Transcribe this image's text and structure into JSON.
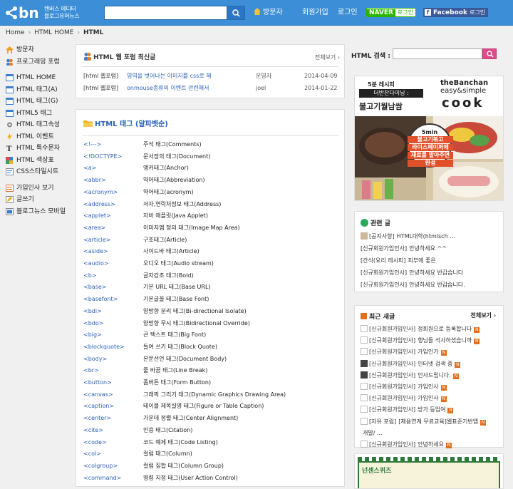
{
  "header": {
    "logo_text": "bn",
    "logo_tagline_1": "캔버스 에디터",
    "logo_tagline_2": "블로그유머뉴스",
    "search_placeholder": "",
    "nav_visitor": "방문자",
    "nav_join": "회원가입",
    "nav_login": "로그인",
    "naver_badge": "NAVER",
    "naver_login": "로그인",
    "facebook_badge": "Facebook",
    "facebook_login": "로그인"
  },
  "breadcrumb": [
    "Home",
    "HTML HOME",
    "HTML"
  ],
  "left_nav": {
    "group1": [
      {
        "label": "방문자",
        "icon": "house-icon"
      },
      {
        "label": "프로그래밍 포럼",
        "icon": "people-icon"
      }
    ],
    "group2": [
      {
        "label": "HTML HOME",
        "icon": "home-page-icon"
      },
      {
        "label": "HTML 태그(A)",
        "icon": "page-icon"
      },
      {
        "label": "HTML 태그(G)",
        "icon": "page-icon"
      },
      {
        "label": "HTML5 태그",
        "icon": "page-icon"
      },
      {
        "label": "HTML 태그속성",
        "icon": "gear-icon"
      },
      {
        "label": "HTML 이벤트",
        "icon": "lightning-icon"
      },
      {
        "label": "HTML 특수문자",
        "icon": "text-icon"
      },
      {
        "label": "HTML 색상표",
        "icon": "palette-icon"
      },
      {
        "label": "CSS스타일시트",
        "icon": "css-icon"
      }
    ],
    "group3": [
      {
        "label": "가입인사 보기",
        "icon": "note-icon"
      },
      {
        "label": "글쓰기",
        "icon": "pencil-icon"
      },
      {
        "label": "블로그뉴스 모바일",
        "icon": "mobile-icon"
      }
    ]
  },
  "forum_panel": {
    "title": "HTML 웹 포럼 최신글",
    "more": "전체보기 ›",
    "rows": [
      {
        "category": "[html 웹포럼]",
        "subject": "영역을 벗어나는 이미지를 css로 해",
        "author": "운영자",
        "date": "2014-04-09"
      },
      {
        "category": "[html 웹포럼]",
        "subject": "onmouse종류의 이벤트 관련해서",
        "author": "joel",
        "date": "2014-01-22"
      }
    ]
  },
  "tags_panel": {
    "title": "HTML 태그 (알파벳순)",
    "rows": [
      {
        "tag": "<!--->",
        "desc": "주석 태그(Comments)"
      },
      {
        "tag": "<!DOCTYPE>",
        "desc": "문서정의 태그(Document)"
      },
      {
        "tag": "<a>",
        "desc": "앵커태그(Anchor)"
      },
      {
        "tag": "<abbr>",
        "desc": "약어태그(Abbreviation)"
      },
      {
        "tag": "<acronym>",
        "desc": "약어태그(acronym)"
      },
      {
        "tag": "<address>",
        "desc": "저자,연락처정보 태그(Address)"
      },
      {
        "tag": "<applet>",
        "desc": "자바 애플릿(Java Applet)"
      },
      {
        "tag": "<area>",
        "desc": "이미지맵 정의 태그(Image Map Area)"
      },
      {
        "tag": "<article>",
        "desc": "구조태그(Article)"
      },
      {
        "tag": "<aside>",
        "desc": "사이드바 태그(Article)"
      },
      {
        "tag": "<audio>",
        "desc": "오디오 태그(Audio stream)"
      },
      {
        "tag": "<b>",
        "desc": "글자강조 태그(Bold)"
      },
      {
        "tag": "<base>",
        "desc": "기본 URL 태그(Base URL)"
      },
      {
        "tag": "<basefont>",
        "desc": "기본글꼴 태그(Base Font)"
      },
      {
        "tag": "<bdi>",
        "desc": "양방향 분리 태그(Bi-directional Isolate)"
      },
      {
        "tag": "<bdo>",
        "desc": "양방향 무시 태그(Bidirectional Override)"
      },
      {
        "tag": "<big>",
        "desc": "큰 텍스트 태그(Big Font)"
      },
      {
        "tag": "<blockquote>",
        "desc": "들여 쓰기 태그(Block Quote)"
      },
      {
        "tag": "<body>",
        "desc": "본문선언 태그(Document Body)"
      },
      {
        "tag": "<br>",
        "desc": "줄 바꿈 태그(Line Break)"
      },
      {
        "tag": "<button>",
        "desc": "폼버튼 태그(Form Button)"
      },
      {
        "tag": "<canvas>",
        "desc": "그래픽 그리기 태그(Dynamic Graphics Drawing Area)"
      },
      {
        "tag": "<caption>",
        "desc": "테이블 제목설명 태그(Figure or Table Caption)"
      },
      {
        "tag": "<center>",
        "desc": "가운데 정렬 태그(Center Alignment)"
      },
      {
        "tag": "<cite>",
        "desc": "인용 태그(Citation)"
      },
      {
        "tag": "<code>",
        "desc": "코드 예제 태그(Code Listing)"
      },
      {
        "tag": "<col>",
        "desc": "컬럼 태그(Column)"
      },
      {
        "tag": "<colgroup>",
        "desc": "컬럼 집합 태그(Column Group)"
      },
      {
        "tag": "<command>",
        "desc": "명령 지정 태그(User Action Control)"
      }
    ]
  },
  "right_search": {
    "label": "HTML 검색 :",
    "placeholder": ""
  },
  "ad": {
    "line1": "5분 레시피",
    "line2": "더반찬다이닝 :",
    "line3": "불고기월남쌈",
    "brand1": "theBanchan",
    "brand2": "easy&simple",
    "brand3": "cook",
    "timer": "5min",
    "caption1": "불고기볶고",
    "caption2": "라이스페이퍼에",
    "caption3": "재료를 말아주면",
    "caption4": "완성"
  },
  "related": {
    "title": "관련 글",
    "rows": [
      {
        "category": "[공지사항]",
        "text": "HTML대학(htmlsch ...",
        "avatar": true
      },
      {
        "category": "[신규회원가입인사]",
        "text": "안녕하세요 ^^",
        "avatar": false
      },
      {
        "category": "[간식(요리 레시피]",
        "text": "피부에 좋은",
        "avatar": false
      },
      {
        "category": "[신규회원가입인사]",
        "text": "안녕하세요 반갑습니다",
        "avatar": false
      },
      {
        "category": "[신규회원가입인사]",
        "text": "안녕하세요 반갑습니다.",
        "avatar": false
      }
    ]
  },
  "comments": {
    "title": "최근 새글",
    "more": "전체보기 ›",
    "rows": [
      {
        "name": "[신규회원가입인사]",
        "text": "정회원으로 등록합니다",
        "dark": false
      },
      {
        "name": "[신규회원가입인사]",
        "text": "행님들 석사하셨습니까",
        "dark": false
      },
      {
        "name": "[신규회원가입인사]",
        "text": "가입인가",
        "dark": false
      },
      {
        "name": "[신규회원가입인사]",
        "text": "인터넷 검색 중",
        "dark": true
      },
      {
        "name": "[신규회원가입인사]",
        "text": "인사드립니다.",
        "dark": true
      },
      {
        "name": "[신규회원가입인사]",
        "text": "가입인사",
        "dark": false
      },
      {
        "name": "[신규회원가입인사]",
        "text": "가입인사",
        "dark": false
      },
      {
        "name": "[신규회원가입인사]",
        "text": "방가 등업여",
        "dark": false
      },
      {
        "name": "[자유 포럼]",
        "text": "[채용연계 무료교육]웹표준기반앱",
        "dark": false
      },
      {
        "name": "",
        "text": "개발/ ...",
        "dark": false
      },
      {
        "name": "[신규회원가입인사]",
        "text": "안녕하세요",
        "dark": false
      }
    ]
  },
  "quiz": {
    "title": "넌센스퀴즈"
  },
  "colors": {
    "header": "#3c8fd6",
    "link": "#2a62b8",
    "pink": "#e04a8a",
    "new_badge": "#e07020"
  }
}
